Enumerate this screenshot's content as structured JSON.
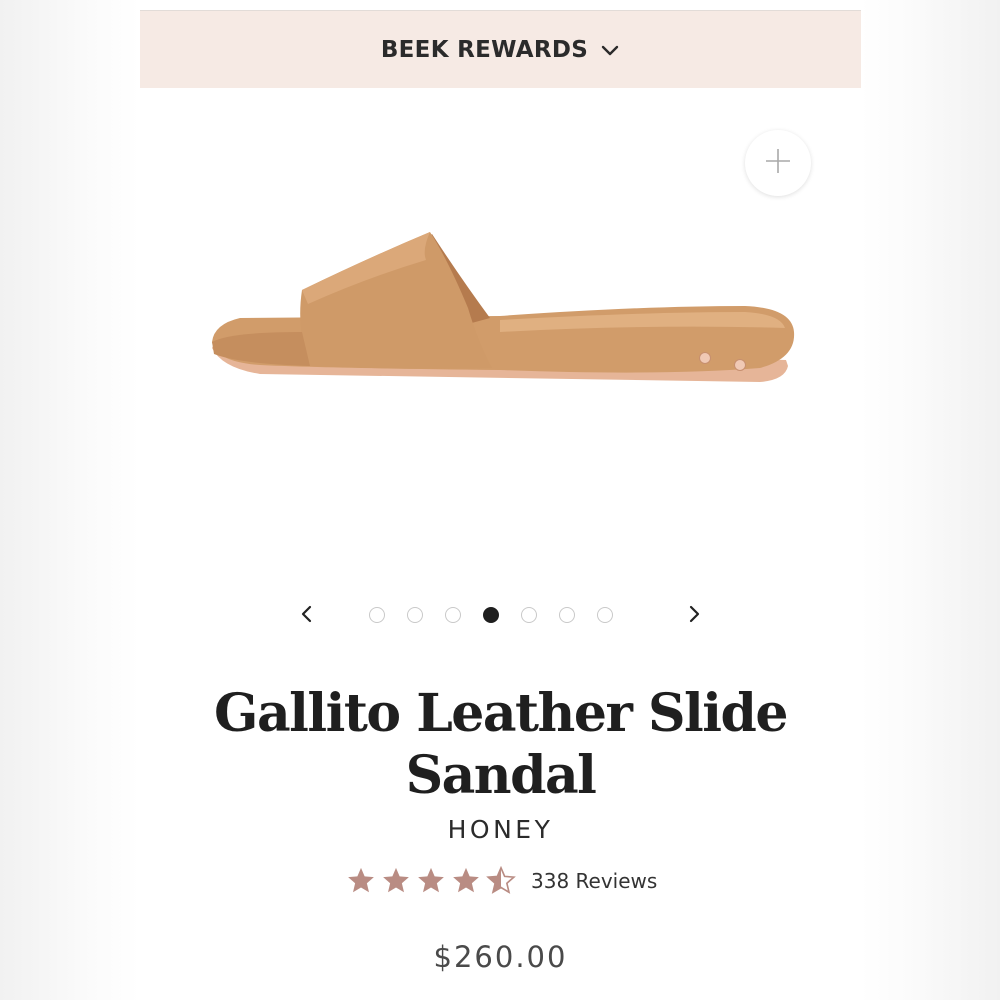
{
  "banner": {
    "rewards_label": "BEEK REWARDS",
    "background": "#f6eae4"
  },
  "gallery": {
    "image_alt": "Gallito Leather Slide Sandal in Honey",
    "slide_count": 7,
    "active_slide": 4,
    "icons": [
      "plus-icon",
      "chevron-left-icon",
      "chevron-right-icon"
    ]
  },
  "product": {
    "title": "Gallito Leather Slide Sandal",
    "color": "HONEY",
    "rating": 4.5,
    "rating_max": 5,
    "reviews_label": "338 Reviews",
    "price": "$260.00"
  },
  "colors": {
    "star": "#b98c83",
    "leather": "#d49f6e"
  }
}
